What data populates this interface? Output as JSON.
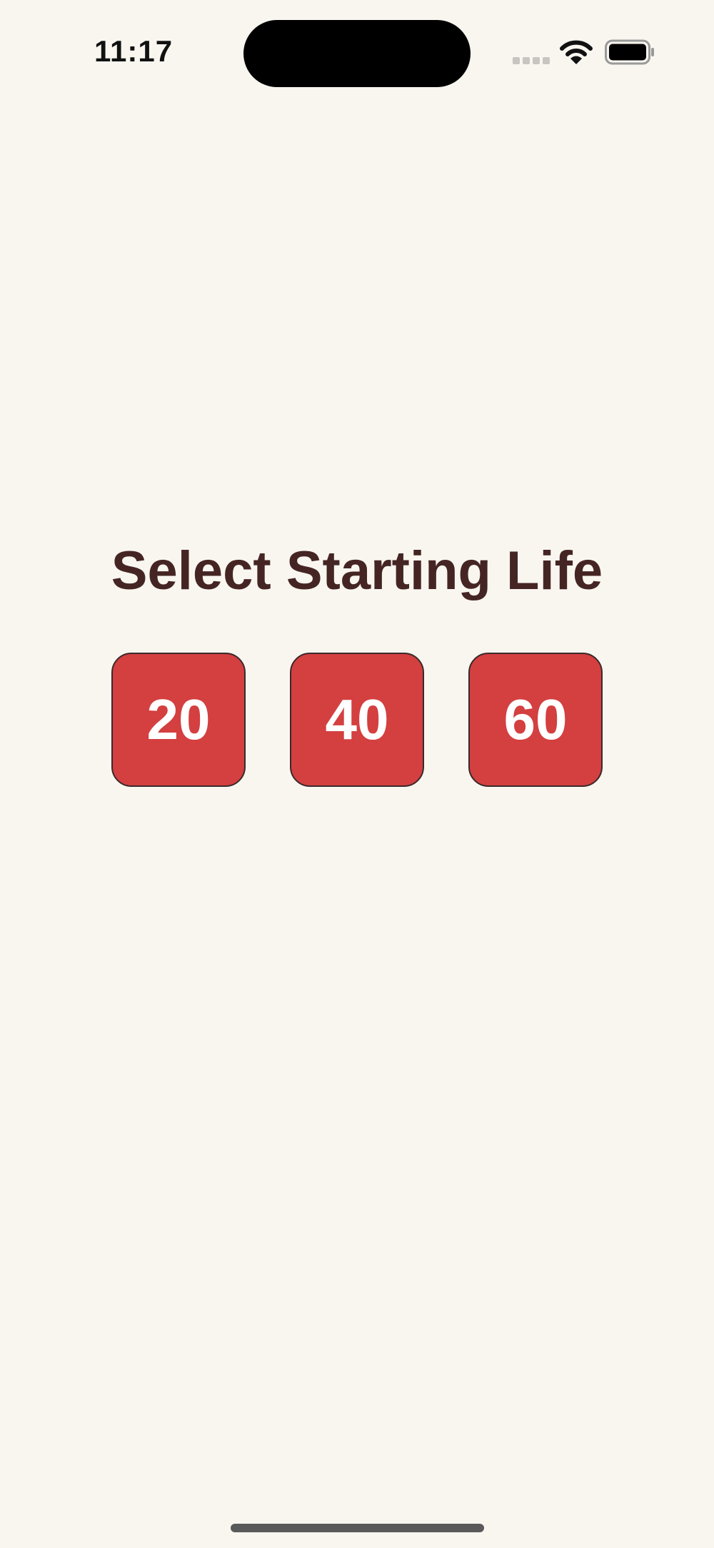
{
  "status_bar": {
    "time": "11:17",
    "wifi_icon": "wifi-icon",
    "battery_icon": "battery-full-icon"
  },
  "screen": {
    "title": "Select Starting Life",
    "options": [
      {
        "label": "20"
      },
      {
        "label": "40"
      },
      {
        "label": "60"
      }
    ]
  },
  "colors": {
    "background": "#f9f6f0",
    "title": "#452524",
    "button": "#d43f40",
    "button_text": "#ffffff"
  }
}
